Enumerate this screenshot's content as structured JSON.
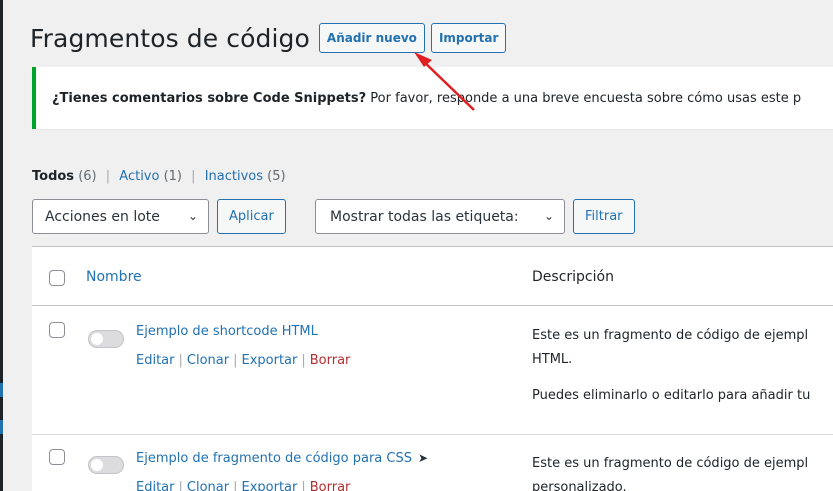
{
  "page": {
    "title": "Fragmentos de código",
    "add_new_label": "Añadir nuevo",
    "import_label": "Importar"
  },
  "notice": {
    "bold": "¿Tienes comentarios sobre Code Snippets?",
    "text": " Por favor, responde a una breve encuesta sobre cómo usas este p"
  },
  "views": [
    {
      "label": "Todos",
      "count": "(6)"
    },
    {
      "label": "Activo",
      "count": "(1)"
    },
    {
      "label": "Inactivos",
      "count": "(5)"
    }
  ],
  "filters": {
    "bulk_actions": "Acciones en lote",
    "apply_label": "Aplicar",
    "tags_filter": "Mostrar todas las etiqueta:",
    "filter_label": "Filtrar"
  },
  "table": {
    "columns": [
      "Nombre",
      "Descripción"
    ],
    "rows": [
      {
        "name": "Ejemplo de shortcode HTML",
        "actions": [
          "Editar",
          "Clonar",
          "Exportar",
          "Borrar"
        ],
        "description_lines": [
          "Este es un fragmento de código de ejempl",
          "HTML.",
          "Puedes eliminarlo o editarlo para añadir tu"
        ],
        "active": false
      },
      {
        "name": "Ejemplo de fragmento de código para CSS",
        "actions": [
          "Editar",
          "Clonar",
          "Exportar",
          "Borrar"
        ],
        "description_lines": [
          "Este es un fragmento de código de ejempl",
          "personalizado."
        ],
        "active": false
      }
    ]
  },
  "colors": {
    "link": "#2271b1",
    "delete": "#b32d2e",
    "notice_border": "#00a32a",
    "annotation_arrow": "#e02020"
  }
}
